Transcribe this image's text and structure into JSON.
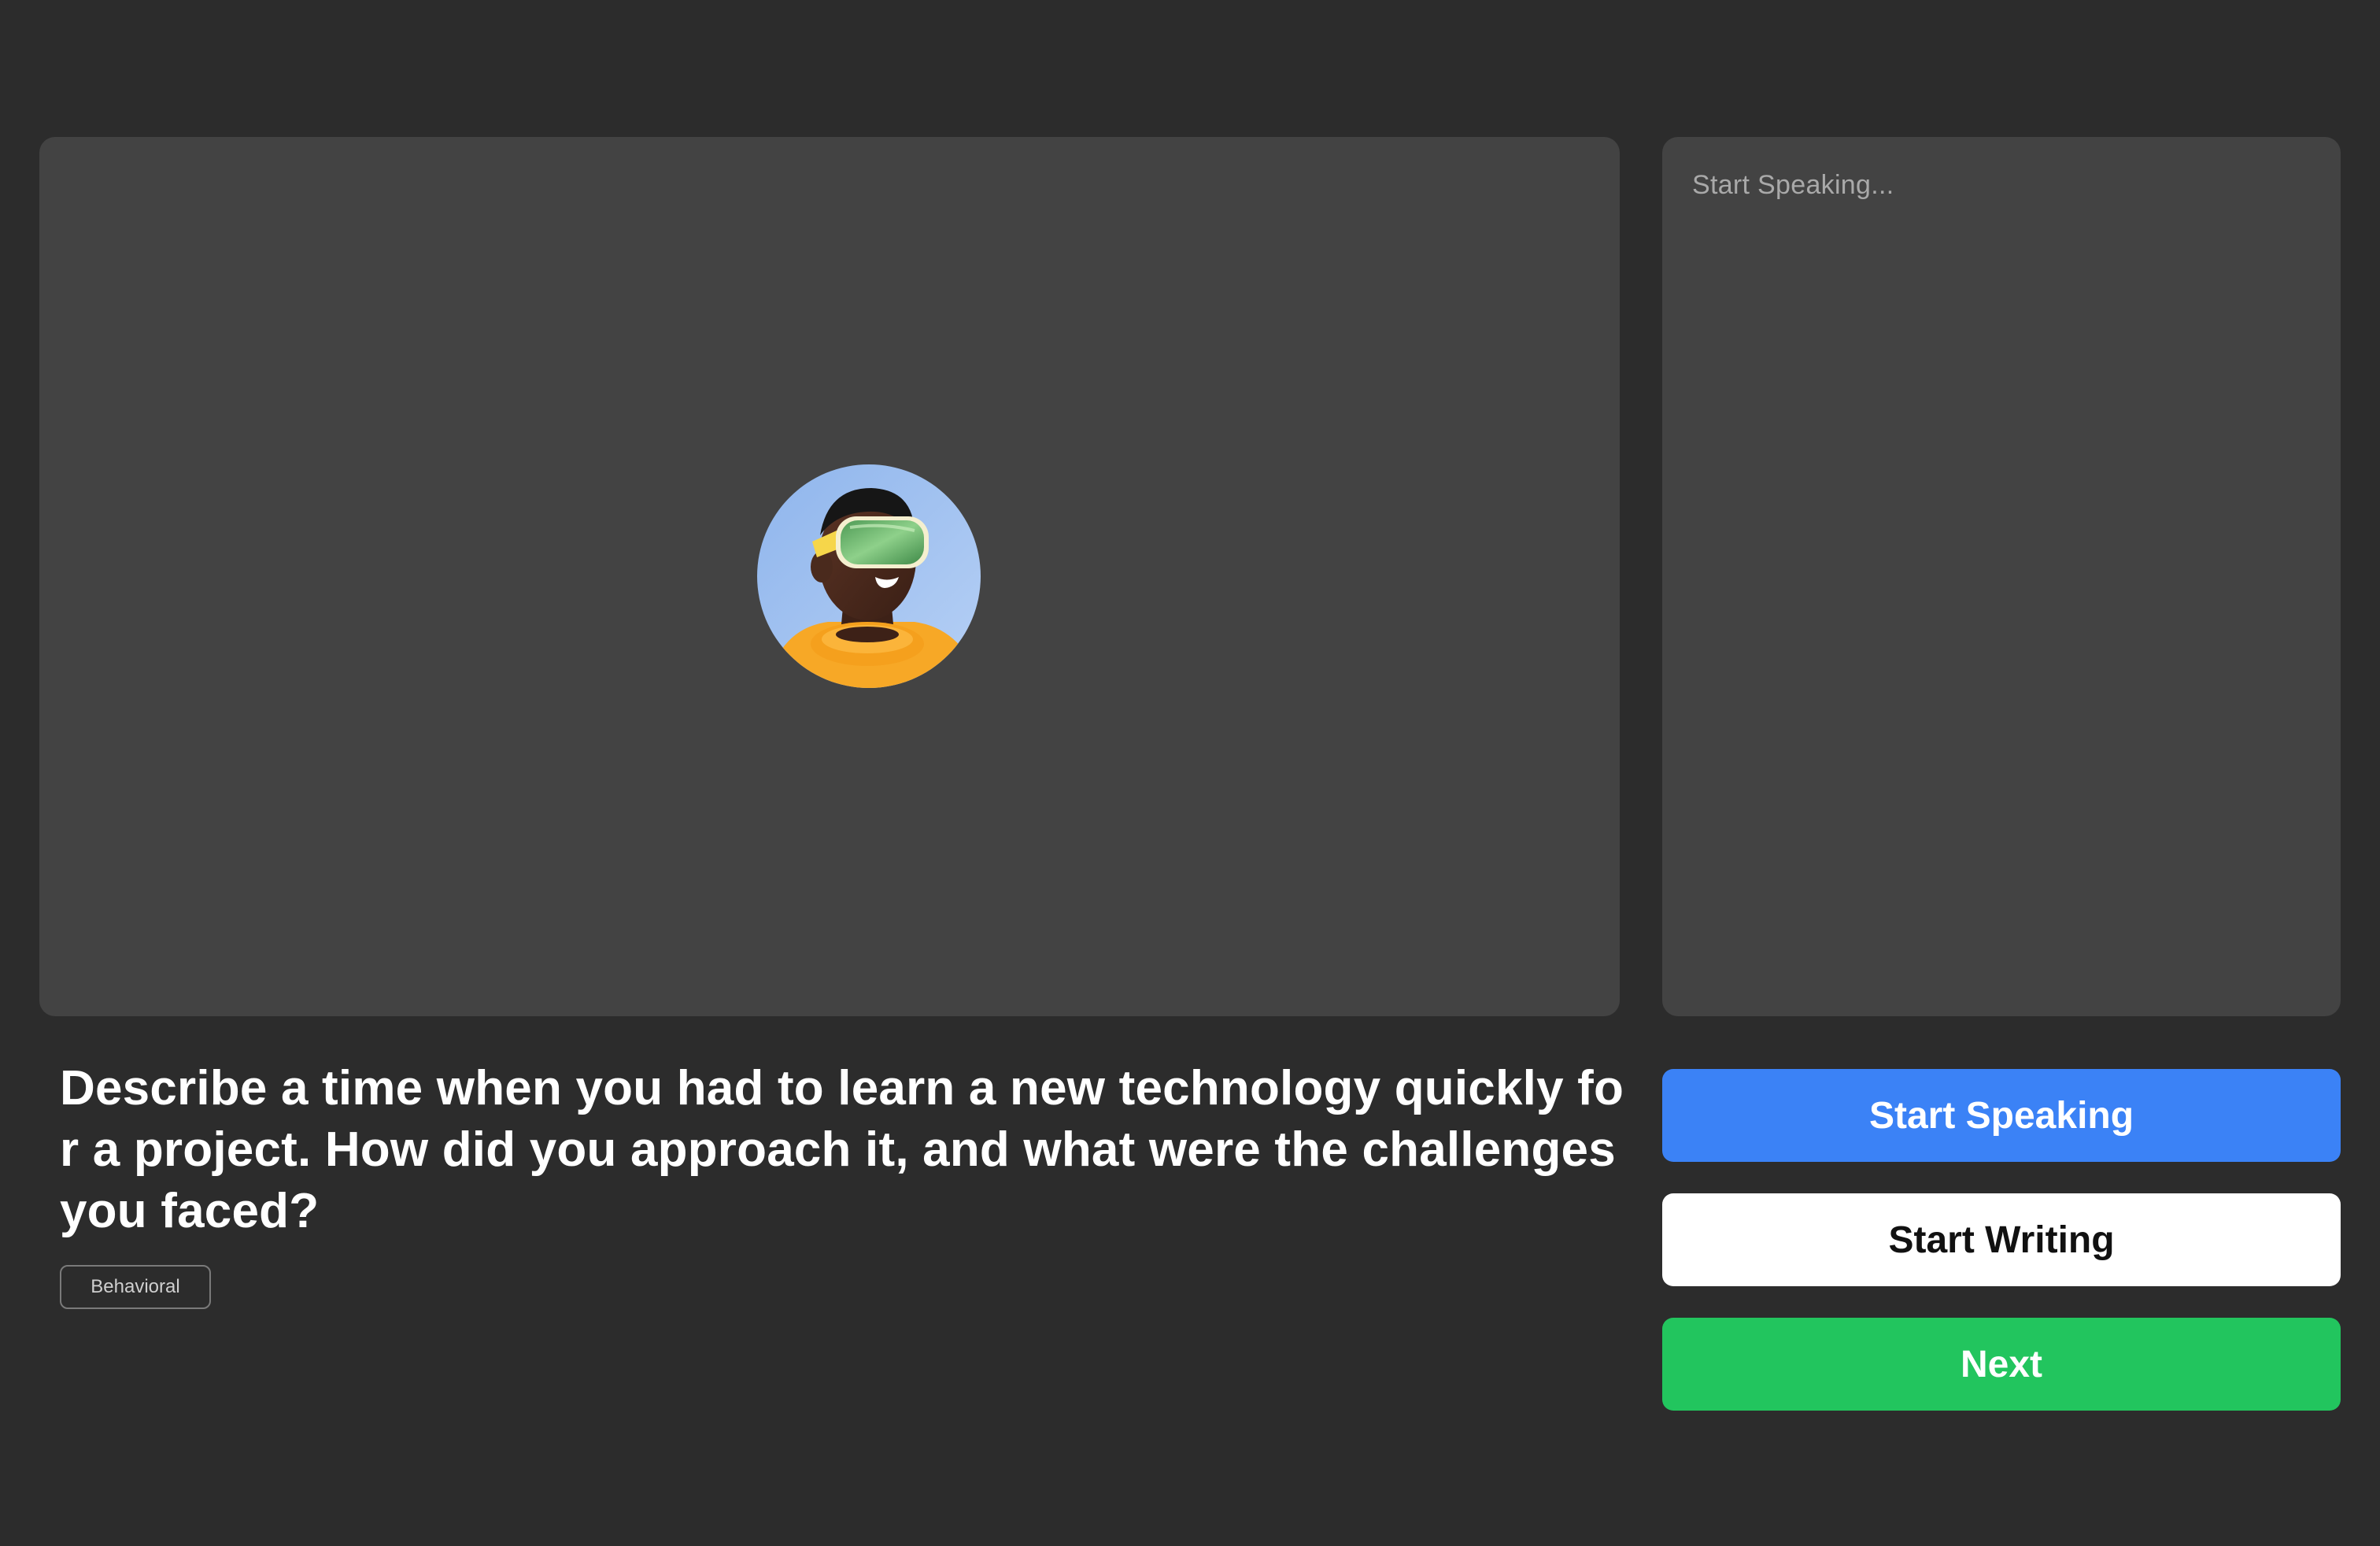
{
  "video_panel": {
    "avatar_icon": "vr-headset-person-avatar"
  },
  "transcript": {
    "placeholder": "Start Speaking..."
  },
  "question": {
    "text": "Describe a time when you had to learn a new technology quickly for a project. How did you approach it, and what were the challenges you faced?",
    "tag": "Behavioral"
  },
  "actions": {
    "start_speaking": "Start Speaking",
    "start_writing": "Start Writing",
    "next": "Next"
  },
  "colors": {
    "background": "#2c2c2c",
    "panel": "#434343",
    "primary_blue": "#3b82f6",
    "success_green": "#22c55e",
    "white": "#ffffff"
  }
}
